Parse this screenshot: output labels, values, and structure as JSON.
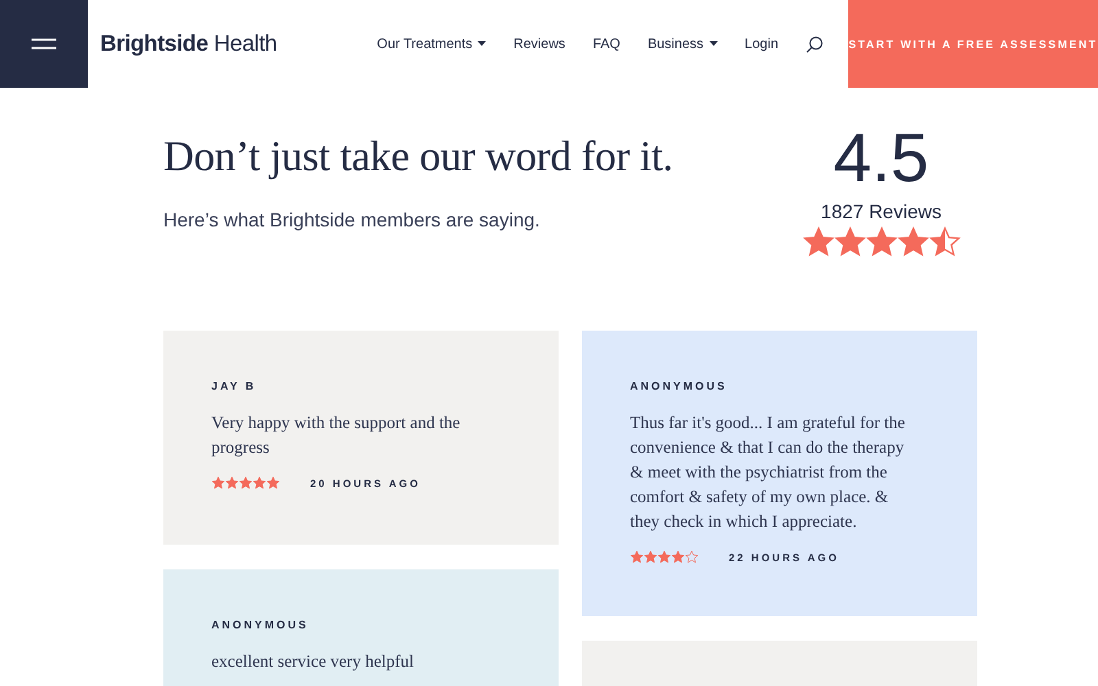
{
  "header": {
    "logo": {
      "bold": "Brightside",
      "light": "Health"
    },
    "nav": [
      {
        "label": "Our Treatments",
        "dropdown": true
      },
      {
        "label": "Reviews",
        "dropdown": false
      },
      {
        "label": "FAQ",
        "dropdown": false
      },
      {
        "label": "Business",
        "dropdown": true
      },
      {
        "label": "Login",
        "dropdown": false
      }
    ],
    "cta": "START WITH A FREE ASSESSMENT"
  },
  "hero": {
    "title": "Don’t just take our word for it.",
    "subtitle": "Here’s what Brightside members are saying.",
    "rating": "4.5",
    "review_count": "1827 Reviews",
    "stars": 4.5
  },
  "columns": [
    {
      "cards": [
        {
          "color": "#f2f1ef",
          "author": "JAY B",
          "text": "Very happy with the support and the progress",
          "stars": 5,
          "time": "20 HOURS AGO"
        },
        {
          "color": "#e1eef3",
          "author": "ANONYMOUS",
          "text": "excellent service very helpful"
        }
      ]
    },
    {
      "cards": [
        {
          "color": "#dde9fb",
          "author": "ANONYMOUS",
          "text": "Thus far it's good... I am grateful for the convenience & that I can do the therapy & meet with the psychiatrist from the comfort & safety of my own place. & they check in which I appreciate.",
          "stars": 4,
          "time": "22 HOURS AGO"
        },
        {
          "color": "#f2f1ef"
        }
      ]
    }
  ]
}
